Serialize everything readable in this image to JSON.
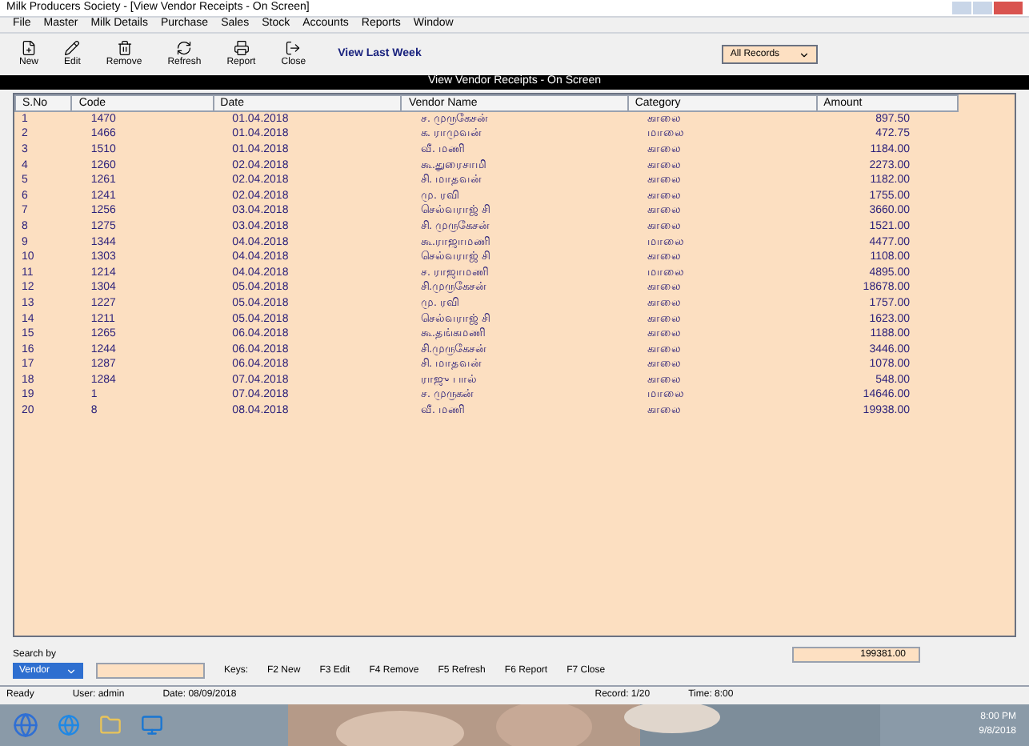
{
  "window": {
    "title": "Milk Producers Society - [View Vendor Receipts - On Screen]"
  },
  "menu": [
    "File",
    "Master",
    "Milk Details",
    "Purchase",
    "Sales",
    "Stock",
    "Accounts",
    "Reports",
    "Window"
  ],
  "toolbar": [
    {
      "label": "New",
      "kind": "new"
    },
    {
      "label": "Edit",
      "kind": "edit"
    },
    {
      "label": "Remove",
      "kind": "remove"
    },
    {
      "label": "Refresh",
      "kind": "refresh"
    },
    {
      "label": "Report",
      "kind": "report"
    },
    {
      "label": "Close",
      "kind": "close"
    }
  ],
  "filter_link": "View Last Week",
  "filter_select": {
    "value": "All Records"
  },
  "header": "View Vendor Receipts - On Screen",
  "table": {
    "columns": [
      "S.No",
      "Code",
      "Date",
      "Vendor Name",
      "Category",
      "Amount"
    ],
    "rows": [
      [
        "1",
        "1470",
        "01.04.2018",
        "ச. முருகேசன்",
        "காலை",
        "897.50"
      ],
      [
        "2",
        "1466",
        "01.04.2018",
        "க. ராமுவன்",
        "மாலை",
        "472.75"
      ],
      [
        "3",
        "1510",
        "01.04.2018",
        "வீ. மணி",
        "காலை",
        "1184.00"
      ],
      [
        "4",
        "1260",
        "02.04.2018",
        "கூ.துரைசாமி",
        "காலை",
        "2273.00"
      ],
      [
        "5",
        "1261",
        "02.04.2018",
        "சி. மாதவன்",
        "காலை",
        "1182.00"
      ],
      [
        "6",
        "1241",
        "02.04.2018",
        "மு. ரவி",
        "காலை",
        "1755.00"
      ],
      [
        "7",
        "1256",
        "03.04.2018",
        "செல்வராஜ் சி",
        "காலை",
        "3660.00"
      ],
      [
        "8",
        "1275",
        "03.04.2018",
        "சி. முருகேசன்",
        "காலை",
        "1521.00"
      ],
      [
        "9",
        "1344",
        "04.04.2018",
        "கூ.ராஜாமணி",
        "மாலை",
        "4477.00"
      ],
      [
        "10",
        "1303",
        "04.04.2018",
        "செல்வராஜ் சி",
        "காலை",
        "1108.00"
      ],
      [
        "11",
        "1214",
        "04.04.2018",
        "ச. ராஜாமணி",
        "மாலை",
        "4895.00"
      ],
      [
        "12",
        "1304",
        "05.04.2018",
        "சி.முருகேசன்",
        "காலை",
        "18678.00"
      ],
      [
        "13",
        "1227",
        "05.04.2018",
        "மு. ரவி",
        "காலை",
        "1757.00"
      ],
      [
        "14",
        "1211",
        "05.04.2018",
        "செல்வராஜ் சி",
        "காலை",
        "1623.00"
      ],
      [
        "15",
        "1265",
        "06.04.2018",
        "கூ.தங்கமணி",
        "காலை",
        "1188.00"
      ],
      [
        "16",
        "1244",
        "06.04.2018",
        "சி.முருகேசன்",
        "காலை",
        "3446.00"
      ],
      [
        "17",
        "1287",
        "06.04.2018",
        "சி. மாதவன்",
        "காலை",
        "1078.00"
      ],
      [
        "18",
        "1284",
        "07.04.2018",
        "ராஜு பால்",
        "காலை",
        "548.00"
      ],
      [
        "19",
        "1",
        "07.04.2018",
        "ச. முருகன்",
        "மாலை",
        "14646.00"
      ],
      [
        "20",
        "8",
        "08.04.2018",
        "வீ. மணி",
        "காலை",
        "19938.00"
      ]
    ]
  },
  "search": {
    "label": "Search by",
    "value": "Vendor"
  },
  "keys": [
    "Keys:",
    "F2 New",
    "F3 Edit",
    "F4 Remove",
    "F5 Refresh",
    "F6 Report",
    "F7 Close"
  ],
  "total": "199381.00",
  "status_bar": [
    "Ready",
    "User: admin",
    "Date: 08/09/2018",
    "Record: 1/20",
    "Time: 8:00"
  ],
  "taskbar": {
    "clock_time": "8:00 PM",
    "clock_date": "9/8/2018"
  }
}
